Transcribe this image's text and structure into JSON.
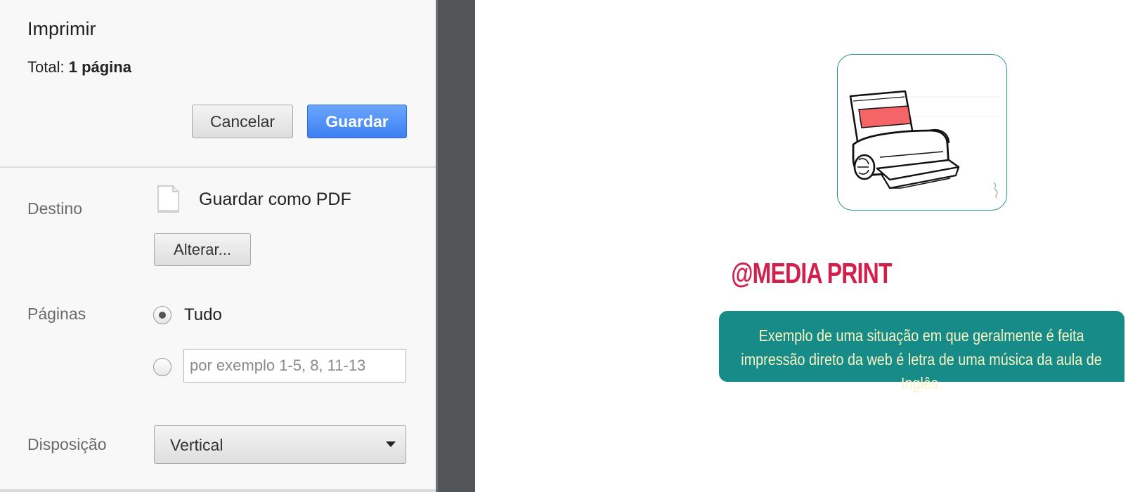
{
  "dialog": {
    "title": "Imprimir",
    "total_label": "Total:",
    "total_value": "1 página",
    "cancel_label": "Cancelar",
    "save_label": "Guardar"
  },
  "destination": {
    "label": "Destino",
    "value": "Guardar como PDF",
    "icon": "document-icon",
    "change_label": "Alterar..."
  },
  "pages": {
    "label": "Páginas",
    "all_label": "Tudo",
    "selected": "all",
    "custom_placeholder": "por exemplo 1-5, 8, 11-13",
    "custom_value": ""
  },
  "layout": {
    "label": "Disposição",
    "selected": "Vertical"
  },
  "preview": {
    "image": "printer-illustration",
    "heading": "@MEDIA PRINT",
    "caption": "Exemplo de uma situação em que geralmente é feita impressão direto da web é letra de uma música da aula de Inglês."
  },
  "colors": {
    "primary_button": "#4a8cf7",
    "heading": "#d21f4c",
    "caption_bg": "#168b87",
    "caption_text": "#f7f3c4",
    "gutter": "#515557"
  }
}
